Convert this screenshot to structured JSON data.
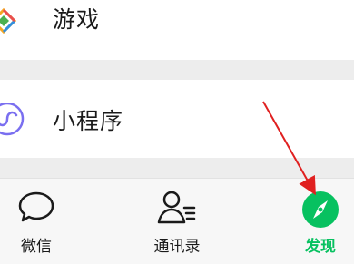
{
  "list": {
    "games_label": "游戏",
    "mini_programs_label": "小程序"
  },
  "tabbar": {
    "chats_label": "微信",
    "contacts_label": "通讯录",
    "discover_label": "发现"
  },
  "colors": {
    "active": "#07c160",
    "arrow": "#e02020",
    "mini_program_icon": "#7a6ff0"
  }
}
